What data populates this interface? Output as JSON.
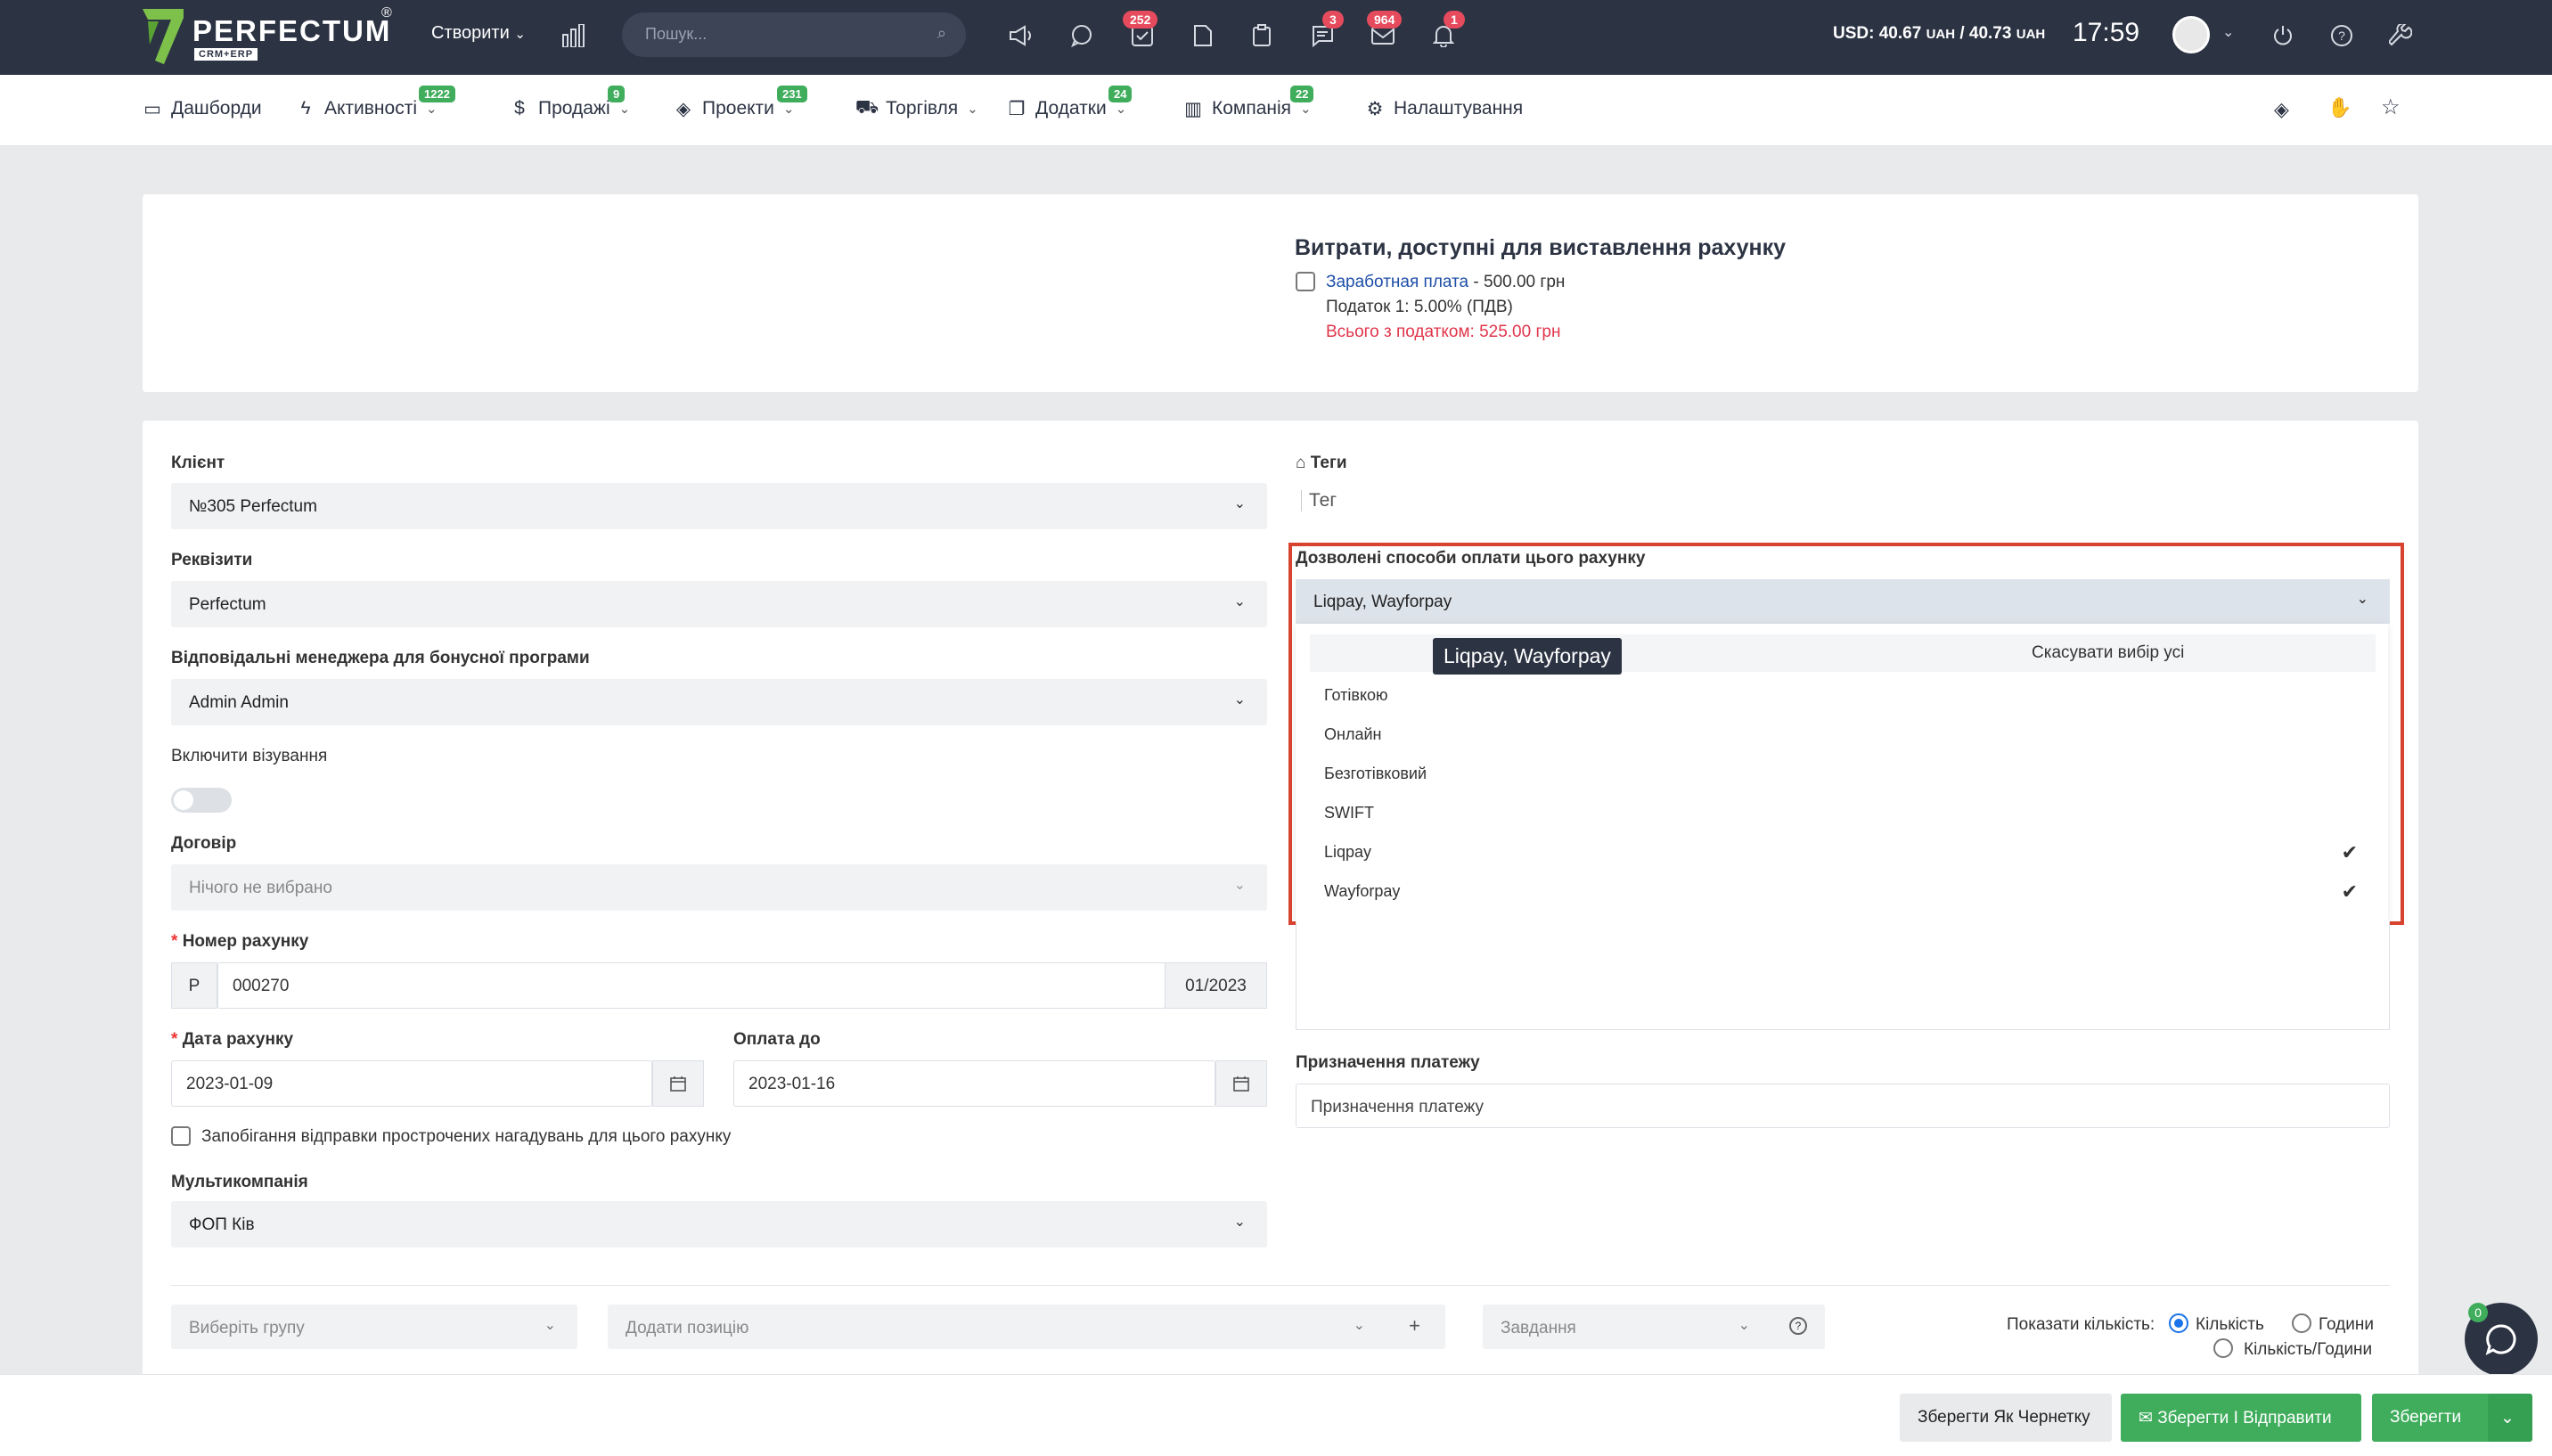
{
  "header": {
    "logo_text": "PERFECTUM",
    "logo_sub": "CRM+ERP",
    "logo_reg": "®",
    "create_label": "Створити",
    "search_placeholder": "Пошук...",
    "badges": {
      "tasks": "252",
      "chat": "3",
      "mail": "964",
      "notifications": "1"
    },
    "rate_usd": "USD: 40.67",
    "rate_uah1": "UAH",
    "rate_sep": " / 40.73",
    "rate_uah2": "UAH",
    "time": "17:59"
  },
  "nav": {
    "items": [
      {
        "label": "Дашборди",
        "icon": "monitor-icon"
      },
      {
        "label": "Активності",
        "badge": "1222",
        "icon": "bolt-icon"
      },
      {
        "label": "Продажі",
        "badge": "9",
        "icon": "dollar-icon"
      },
      {
        "label": "Проекти",
        "badge": "231",
        "icon": "layers-icon"
      },
      {
        "label": "Торгівля",
        "icon": "cart-icon"
      },
      {
        "label": "Додатки",
        "badge": "24",
        "icon": "copy-icon"
      },
      {
        "label": "Компанія",
        "badge": "22",
        "icon": "building-icon"
      },
      {
        "label": "Налаштування",
        "icon": "gear-icon"
      }
    ]
  },
  "expenses": {
    "title": "Витрати, доступні для виставлення рахунку",
    "item_name": "Заработная плата",
    "item_amount": " - 500.00 грн",
    "tax": "Податок 1: 5.00% (ПДВ)",
    "total": "Всього з податком: 525.00 грн"
  },
  "form": {
    "client_label": "Клієнт",
    "client_value": "№305 Perfectum",
    "requisites_label": "Реквізити",
    "requisites_value": "Perfectum",
    "manager_label": "Відповідальні менеджера для бонусної програми",
    "manager_value": "Admin Admin",
    "visa_label": "Включити візування",
    "contract_label": "Договір",
    "contract_value": "Нічого не вибрано",
    "invoice_number_label": "Номер рахунку",
    "invoice_prefix": "P",
    "invoice_number": "000270",
    "invoice_suffix": "01/2023",
    "invoice_date_label": "Дата рахунку",
    "invoice_date": "2023-01-09",
    "due_date_label": "Оплата до",
    "due_date": "2023-01-16",
    "prevent_reminders_label": "Запобігання відправки прострочених нагадувань для цього рахунку",
    "multicompany_label": "Мультикомпанія",
    "multicompany_value": "ФОП Ків",
    "tags_label": "Теги",
    "tags_placeholder": "Тег",
    "payment_methods_label": "Дозволені способи оплати цього рахунку",
    "payment_methods_value": "Liqpay, Wayforpay",
    "deselect_all": "Скасувати вибір усі",
    "tooltip": "Liqpay, Wayforpay",
    "payment_options": [
      "Готівкою",
      "Онлайн",
      "Безготівковий",
      "SWIFT",
      "Liqpay",
      "Wayforpay"
    ],
    "payment_purpose_label": "Призначення платежу",
    "payment_purpose_placeholder": "Призначення платежу"
  },
  "items_bar": {
    "group_placeholder": "Виберіть групу",
    "add_item_placeholder": "Додати позицію",
    "task_placeholder": "Завдання",
    "show_qty_label": "Показати кількість:",
    "opt_qty": "Кількість",
    "opt_hours": "Години",
    "opt_qty_hours": "Кількість/Години"
  },
  "footer": {
    "draft_label": "Зберегти Як Чернетку",
    "save_send_label": "Зберегти І Відправити",
    "save_label": "Зберегти"
  },
  "chat_badge": "0",
  "colors": {
    "topbar": "#2c3343",
    "accent_green": "#3fad5c",
    "badge_red": "#e64b5d",
    "highlight": "#d8432f"
  }
}
